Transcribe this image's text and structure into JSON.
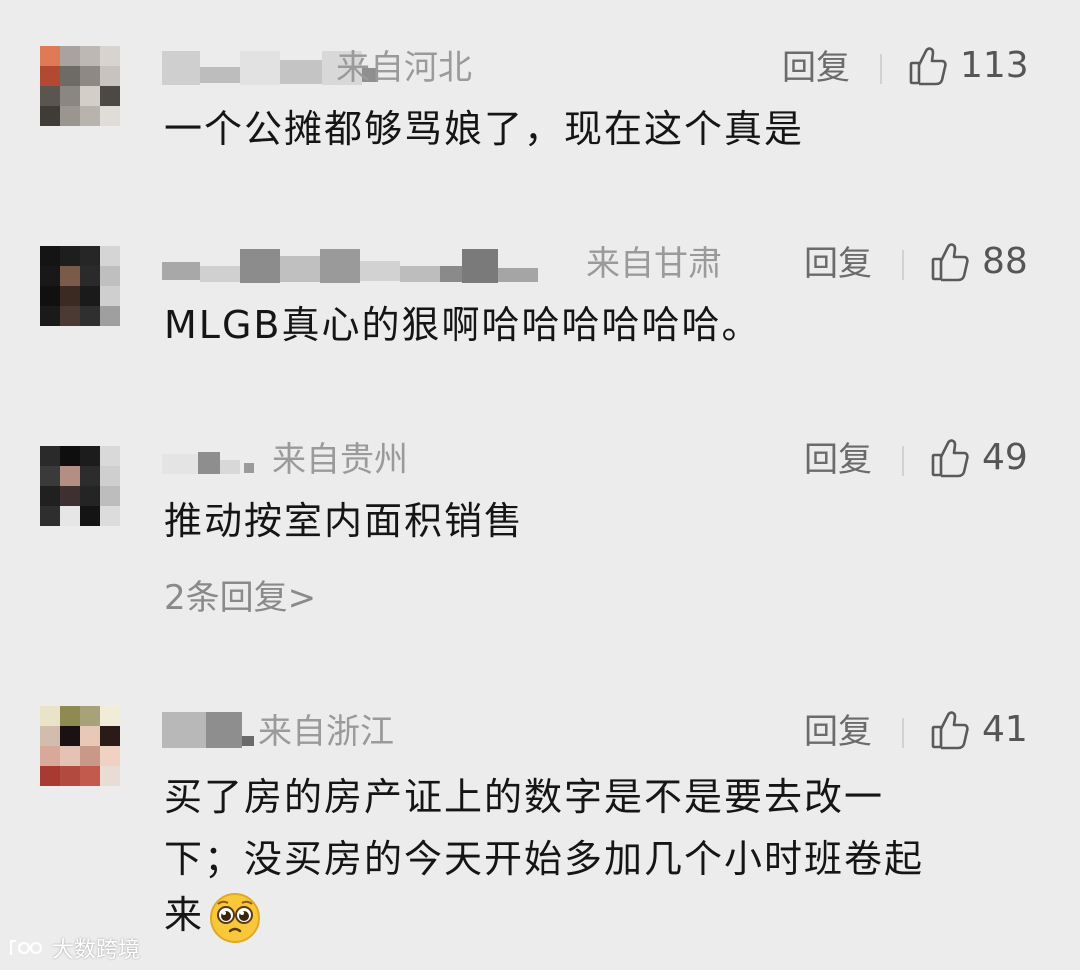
{
  "comments": [
    {
      "region": "来自河北",
      "reply_label": "回复",
      "like_count": "113",
      "text_lines": [
        "一个公摊都够骂娘了，现在这个真是"
      ]
    },
    {
      "region": "来自甘肃",
      "reply_label": "回复",
      "like_count": "88",
      "text_lines": [
        "MLGB真心的狠啊哈哈哈哈哈哈。"
      ]
    },
    {
      "region": "来自贵州",
      "reply_label": "回复",
      "like_count": "49",
      "text_lines": [
        "推动按室内面积销售"
      ],
      "more_replies": "2条回复>"
    },
    {
      "region": "来自浙江",
      "reply_label": "回复",
      "like_count": "41",
      "text_lines": [
        "买了房的房产证上的数字是不是要去改一",
        "下；没买房的今天开始多加几个小时班卷起",
        "来"
      ],
      "emoji": "pleading-face"
    }
  ],
  "watermark": {
    "text": "大数跨境"
  },
  "icons": {
    "like": "thumbs-up-icon"
  },
  "colors": {
    "background": "#ececec",
    "secondary_text": "#9a9a9a",
    "reply_text": "#6b6b6b"
  }
}
